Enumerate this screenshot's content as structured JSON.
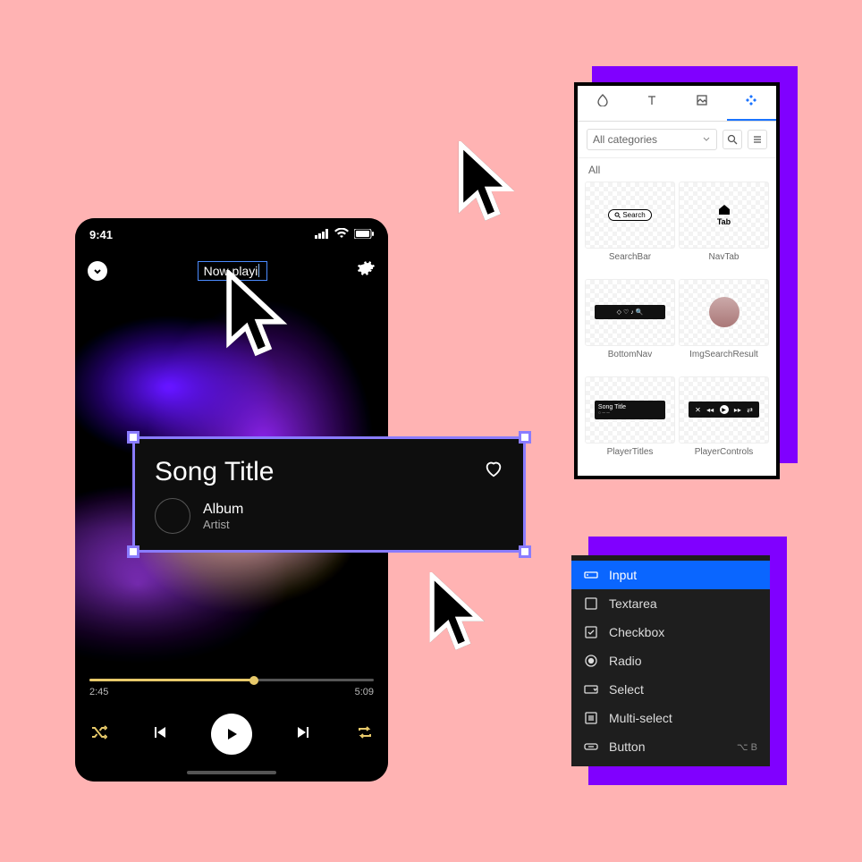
{
  "phone": {
    "clock": "9:41",
    "editing_text": "Now playi",
    "progress": {
      "elapsed": "2:45",
      "total": "5:09"
    }
  },
  "card": {
    "title": "Song Title",
    "album": "Album",
    "artist": "Artist"
  },
  "library": {
    "filter_label": "All categories",
    "section": "All",
    "tiles": [
      {
        "label": "SearchBar"
      },
      {
        "label": "NavTab",
        "tab_text": "Tab"
      },
      {
        "label": "BottomNav"
      },
      {
        "label": "ImgSearchResult"
      },
      {
        "label": "PlayerTitles",
        "song_text": "Song Title"
      },
      {
        "label": "PlayerControls"
      }
    ],
    "search_pill": "Search"
  },
  "menu": {
    "items": [
      {
        "label": "Input",
        "selected": true
      },
      {
        "label": "Textarea"
      },
      {
        "label": "Checkbox"
      },
      {
        "label": "Radio"
      },
      {
        "label": "Select"
      },
      {
        "label": "Multi-select"
      },
      {
        "label": "Button",
        "shortcut": "⌥ B"
      }
    ]
  }
}
